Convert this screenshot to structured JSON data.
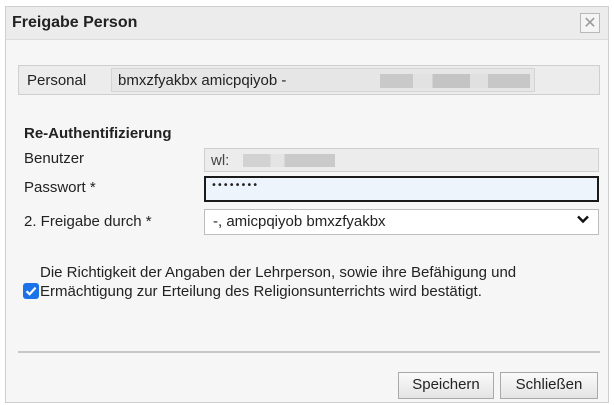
{
  "dialog": {
    "title": "Freigabe Person",
    "close_symbol": "✕"
  },
  "personal": {
    "label": "Personal",
    "value": "bmxzfyakbx amicpqiyob -"
  },
  "reauth": {
    "heading": "Re-Authentifizierung",
    "user_label": "Benutzer",
    "user_value": "wl:",
    "password_label": "Passwort *",
    "password_value": "••••••••",
    "approval_label": "2. Freigabe durch *",
    "approval_value": "-, amicpqiyob bmxzfyakbx"
  },
  "confirmation": {
    "checked": true,
    "text": "Die Richtigkeit der Angaben der Lehrperson, sowie ihre Befähigung und Ermächtigung zur Erteilung des Religionsunterrichts wird bestätigt."
  },
  "buttons": {
    "save": "Speichern",
    "close": "Schließen"
  },
  "colors": {
    "checkbox": "#1a73e8",
    "password_bg": "#eef4fc"
  }
}
